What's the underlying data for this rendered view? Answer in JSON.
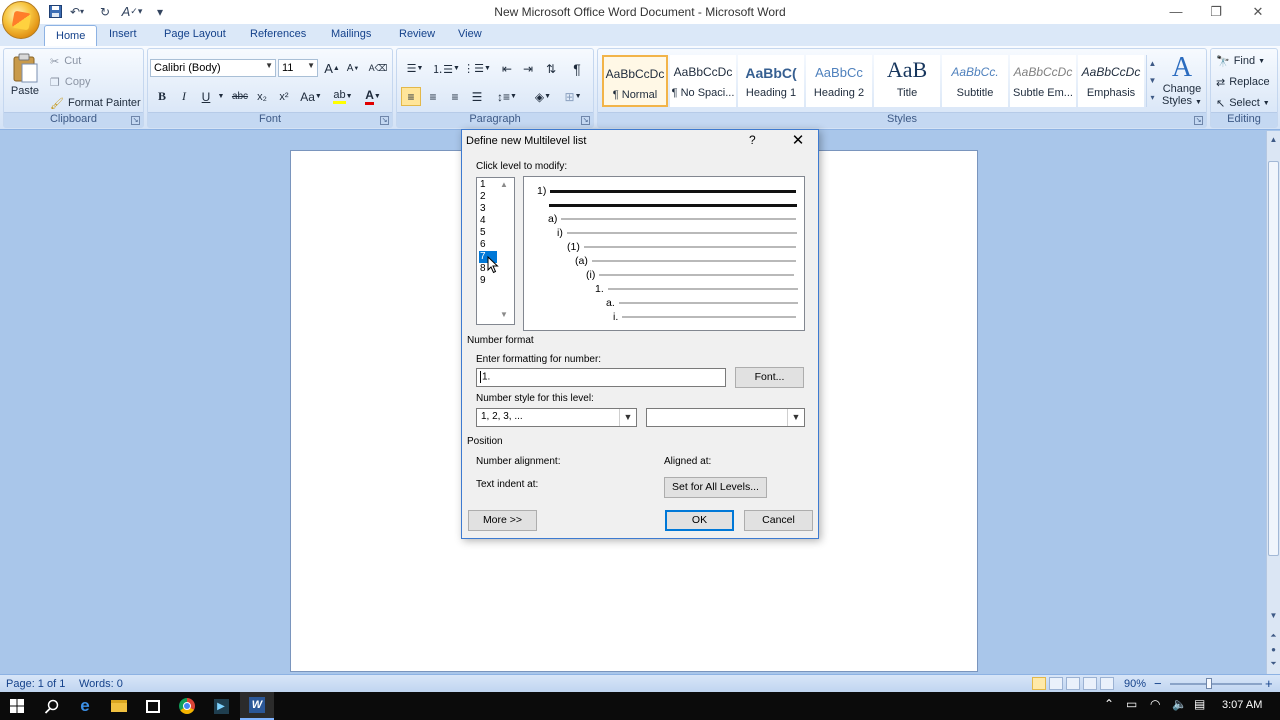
{
  "window": {
    "title": "New Microsoft Office Word Document - Microsoft Word",
    "controls": {
      "minimize": "—",
      "restore": "❐",
      "close": "✕"
    }
  },
  "qat": {
    "save_icon": "save-icon",
    "undo_icon": "undo-icon",
    "redo_icon": "redo-icon",
    "customize": "▾"
  },
  "tabs": [
    "Home",
    "Insert",
    "Page Layout",
    "References",
    "Mailings",
    "Review",
    "View"
  ],
  "clipboard": {
    "paste": "Paste",
    "cut": "Cut",
    "copy": "Copy",
    "format_painter": "Format Painter",
    "label": "Clipboard"
  },
  "font": {
    "name": "Calibri (Body)",
    "size": "11",
    "label": "Font",
    "bold": "B",
    "italic": "I",
    "underline": "U",
    "strike": "abc",
    "subscript": "x₂",
    "superscript": "x²",
    "change_case": "Aa",
    "grow": "A",
    "shrink": "A"
  },
  "paragraph": {
    "label": "Paragraph",
    "pilcrow": "¶"
  },
  "styles": {
    "label": "Styles",
    "items": [
      {
        "sample": "AaBbCcDc",
        "name": "¶ Normal"
      },
      {
        "sample": "AaBbCcDc",
        "name": "¶ No Spaci..."
      },
      {
        "sample": "AaBbC(",
        "name": "Heading 1"
      },
      {
        "sample": "AaBbCc",
        "name": "Heading 2"
      },
      {
        "sample": "AaB",
        "name": "Title"
      },
      {
        "sample": "AaBbCc.",
        "name": "Subtitle"
      },
      {
        "sample": "AaBbCcDc",
        "name": "Subtle Em..."
      },
      {
        "sample": "AaBbCcDc",
        "name": "Emphasis"
      }
    ],
    "change_styles": "Change Styles",
    "change_styles_line1": "Change",
    "change_styles_line2": "Styles"
  },
  "editing": {
    "label": "Editing",
    "find": "Find",
    "replace": "Replace",
    "select": "Select"
  },
  "dialog": {
    "title": "Define new Multilevel list",
    "help": "?",
    "close": "✕",
    "click_level": "Click level to modify:",
    "levels": [
      "1",
      "2",
      "3",
      "4",
      "5",
      "6",
      "7",
      "8",
      "9"
    ],
    "selected_level": "7",
    "preview": [
      "1)",
      "a)",
      "i)",
      "(1)",
      "(a)",
      "(i)",
      "1.",
      "a.",
      "i."
    ],
    "number_format_section": "Number format",
    "enter_formatting_label": "Enter formatting for number:",
    "formatting_value": "1.",
    "font_button": "Font...",
    "number_style_label": "Number style for this level:",
    "number_style_value": "1, 2, 3, ...",
    "include_level_value": "",
    "position_section": "Position",
    "number_alignment": "Number alignment:",
    "aligned_at": "Aligned at:",
    "text_indent": "Text indent at:",
    "set_all_levels": "Set for All Levels...",
    "more": "More >>",
    "ok": "OK",
    "cancel": "Cancel"
  },
  "status": {
    "page": "Page: 1 of 1",
    "words": "Words: 0",
    "zoom": "90%",
    "zoom_out": "−",
    "zoom_in": "+"
  },
  "taskbar": {
    "time": "3:07 AM"
  },
  "colors": {
    "ribbon_tab_text": "#15428b",
    "dialog_accent": "#0078d7",
    "workspace": "#a9c6ea"
  }
}
